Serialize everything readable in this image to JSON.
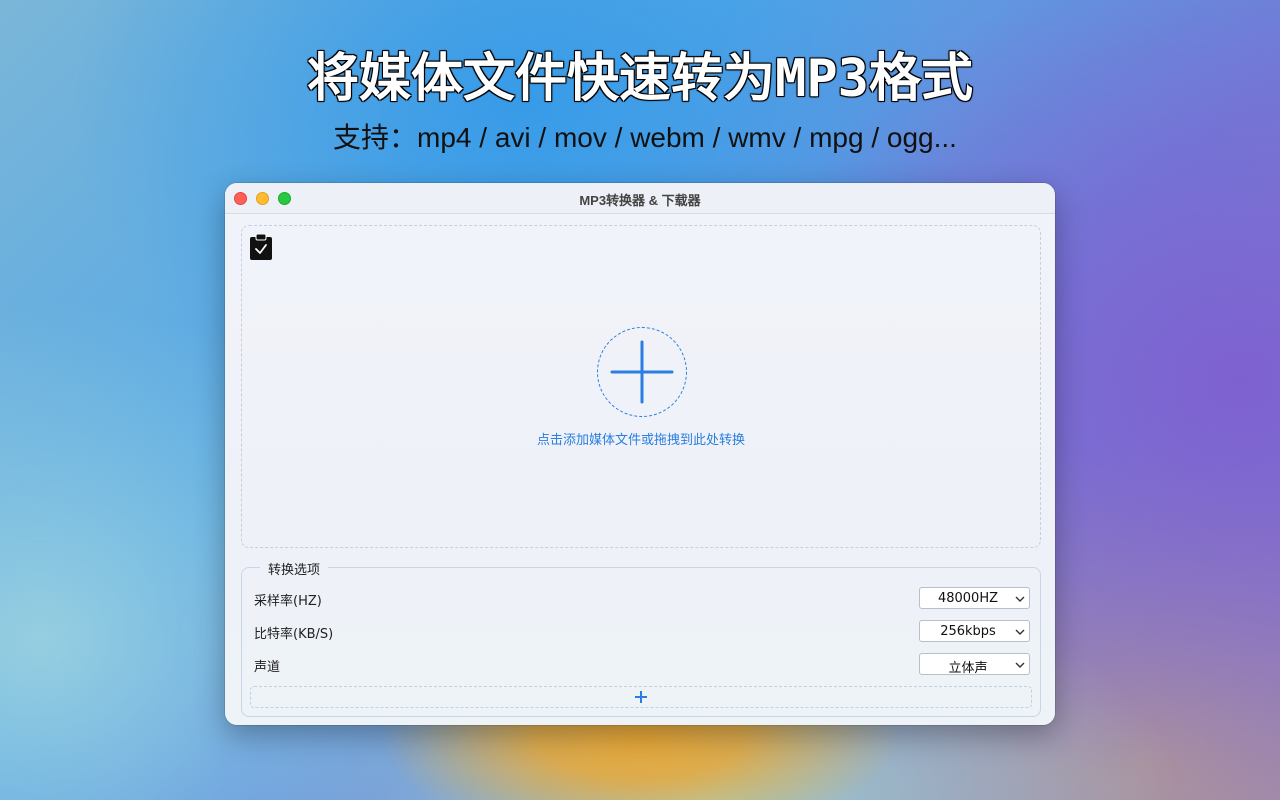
{
  "promo": {
    "headline": "将媒体文件快速转为MP3格式",
    "subline": "支持：mp4 / avi / mov / webm / wmv / mpg / ogg..."
  },
  "window": {
    "title": "MP3转换器 & 下载器"
  },
  "dropzone": {
    "hint": "点击添加媒体文件或拖拽到此处转换",
    "icons": {
      "clipboard": "clipboard-check-icon",
      "add": "plus-icon"
    }
  },
  "options": {
    "legend": "转换选项",
    "sample_rate": {
      "label": "采样率(HZ)",
      "value": "48000HZ"
    },
    "bit_rate": {
      "label": "比特率(KB/S)",
      "value": "256kbps"
    },
    "channel": {
      "label": "声道",
      "value": "立体声"
    }
  },
  "colors": {
    "accent": "#2a7de1",
    "close": "#ff5f57",
    "minimize": "#febc2e",
    "maximize": "#28c840"
  }
}
